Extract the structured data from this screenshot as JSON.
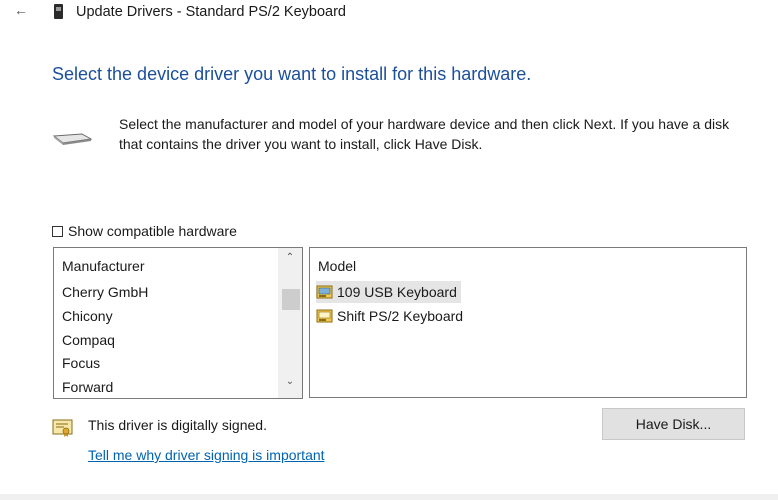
{
  "window": {
    "title": "Update Drivers - Standard PS/2 Keyboard",
    "back_icon": "back-arrow-icon",
    "title_icon": "keyboard-device-icon"
  },
  "header": {
    "text": "Select the device driver you want to install for this hardware."
  },
  "instructions": {
    "text": "Select the manufacturer and model of your hardware device and then click Next. If you have a disk that contains the driver you want to install, click Have Disk."
  },
  "compatible": {
    "label": "Show compatible hardware",
    "checked": false
  },
  "manufacturer_list": {
    "header": "Manufacturer",
    "items": [
      "Cherry GmbH",
      "Chicony",
      "Compaq",
      "Focus",
      "Forward"
    ]
  },
  "model_list": {
    "header": "Model",
    "items": [
      {
        "label": "109 USB Keyboard",
        "selected": true
      },
      {
        "label": "Shift PS/2 Keyboard",
        "selected": false
      }
    ]
  },
  "signing": {
    "status": "This driver is digitally signed.",
    "link": "Tell me why driver signing is important"
  },
  "buttons": {
    "have_disk": "Have Disk..."
  },
  "colors": {
    "header_blue": "#1b4f9c",
    "link_blue": "#0063b1",
    "button_bg": "#e1e1e1",
    "certificate_yellow": "#f2c94c"
  }
}
